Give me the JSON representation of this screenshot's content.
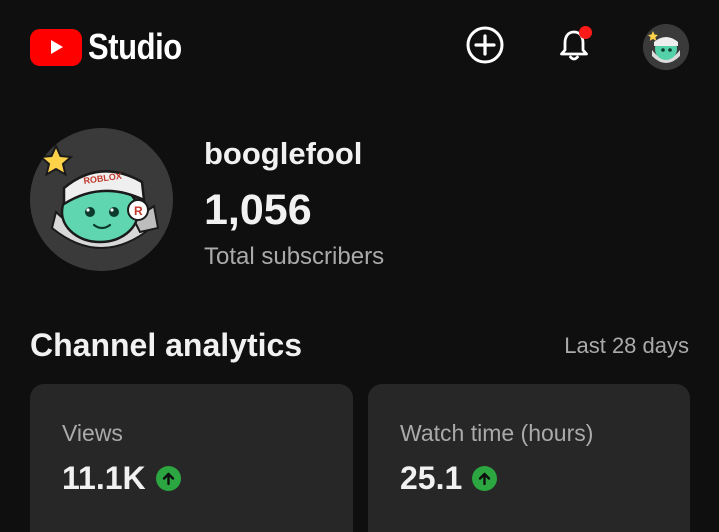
{
  "header": {
    "logo_text": "Studio",
    "brand_color": "#ff0000",
    "create_icon": "plus-circle-icon",
    "notification_icon": "bell-icon",
    "notification_badge_color": "#ff1a1a"
  },
  "channel": {
    "name": "booglefool",
    "subscriber_count": "1,056",
    "subscriber_label": "Total subscribers",
    "avatar_text": "ROBLOX"
  },
  "analytics": {
    "title": "Channel analytics",
    "period": "Last 28 days",
    "cards": [
      {
        "label": "Views",
        "value": "11.1K",
        "trend": "up",
        "trend_icon": "arrow-up-circle-icon",
        "trend_color": "#2ba640"
      },
      {
        "label": "Watch time (hours)",
        "value": "25.1",
        "trend": "up",
        "trend_icon": "arrow-up-circle-icon",
        "trend_color": "#2ba640"
      }
    ]
  }
}
